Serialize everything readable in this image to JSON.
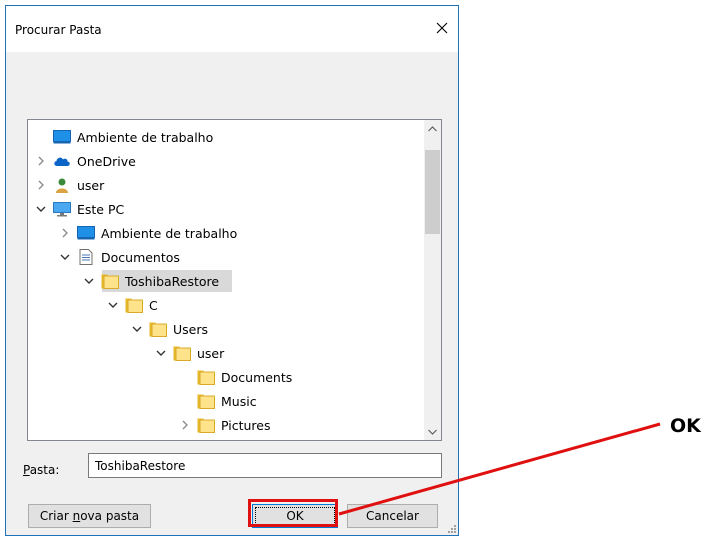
{
  "dialog": {
    "title": "Procurar Pasta",
    "close_glyph": "✕"
  },
  "tree": {
    "items": [
      {
        "label": "Ambiente de trabalho",
        "icon": "desktop-icon",
        "chevron": "none",
        "indent": 0
      },
      {
        "label": "OneDrive",
        "icon": "onedrive-icon",
        "chevron": "right",
        "indent": 0
      },
      {
        "label": "user",
        "icon": "user-icon",
        "chevron": "right",
        "indent": 0
      },
      {
        "label": "Este PC",
        "icon": "pc-icon",
        "chevron": "down",
        "indent": 0
      },
      {
        "label": "Ambiente de trabalho",
        "icon": "desktop-icon",
        "chevron": "right",
        "indent": 1
      },
      {
        "label": "Documentos",
        "icon": "documents-icon",
        "chevron": "down",
        "indent": 1
      },
      {
        "label": "ToshibaRestore",
        "icon": "folder-icon",
        "chevron": "down",
        "indent": 2,
        "selected": true
      },
      {
        "label": "C",
        "icon": "folder-icon",
        "chevron": "down",
        "indent": 3
      },
      {
        "label": "Users",
        "icon": "folder-icon",
        "chevron": "down",
        "indent": 4
      },
      {
        "label": "user",
        "icon": "folder-icon",
        "chevron": "down",
        "indent": 5
      },
      {
        "label": "Documents",
        "icon": "folder-icon",
        "chevron": "none",
        "indent": 6
      },
      {
        "label": "Music",
        "icon": "folder-icon",
        "chevron": "none",
        "indent": 6
      },
      {
        "label": "Pictures",
        "icon": "folder-icon",
        "chevron": "right",
        "indent": 6
      }
    ]
  },
  "pasta": {
    "label_prefix": "P",
    "label_rest": "asta:",
    "value": "ToshibaRestore"
  },
  "buttons": {
    "new_folder_prefix": "Criar ",
    "new_folder_accel": "n",
    "new_folder_rest": "ova pasta",
    "ok": "OK",
    "cancel": "Cancelar"
  },
  "callout": {
    "text": "OK",
    "color": "#e01010"
  }
}
